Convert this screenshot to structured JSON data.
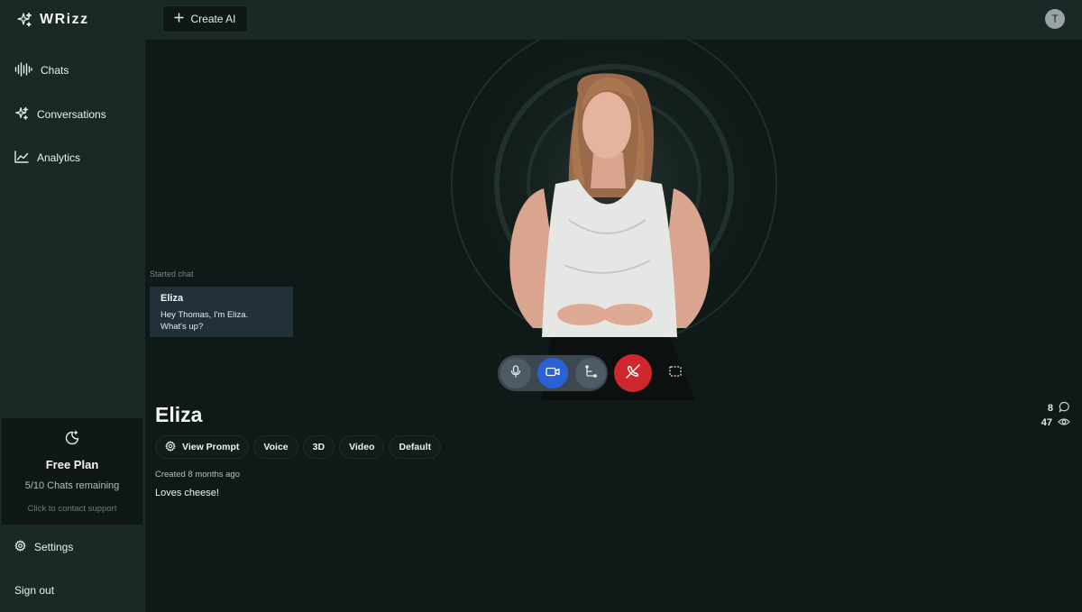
{
  "brand": {
    "name": "WRizz",
    "icon": "sparkles-icon"
  },
  "header": {
    "create_label": "Create AI",
    "user_initial": "T"
  },
  "sidebar": {
    "items": [
      {
        "label": "Chats",
        "icon": "waveform-icon"
      },
      {
        "label": "Conversations",
        "icon": "sparkles-icon"
      },
      {
        "label": "Analytics",
        "icon": "line-chart-icon"
      }
    ],
    "plan": {
      "title": "Free Plan",
      "remaining": "5/10 Chats remaining",
      "support": "Click to contact support",
      "icon": "moon-star-icon"
    },
    "settings_label": "Settings",
    "signout_label": "Sign out"
  },
  "chat": {
    "status": "Started chat",
    "message": {
      "author": "Eliza",
      "lines": [
        "Hey Thomas, I'm Eliza.",
        "What's up?"
      ]
    }
  },
  "controls": {
    "items": [
      "microphone-icon",
      "video-camera-icon",
      "share-icon",
      "end-call-icon",
      "fullscreen-icon"
    ]
  },
  "profile": {
    "name": "Eliza",
    "stats": {
      "messages": "8",
      "views": "47"
    },
    "tags": [
      "View Prompt",
      "Voice",
      "3D",
      "Video",
      "Default"
    ],
    "created": "Created 8 months ago",
    "description": "Loves cheese!"
  },
  "colors": {
    "background": "#0f1a18",
    "panel": "#1a2826",
    "accent_blue": "#2a62d6",
    "end_call_red": "#d0262e"
  }
}
